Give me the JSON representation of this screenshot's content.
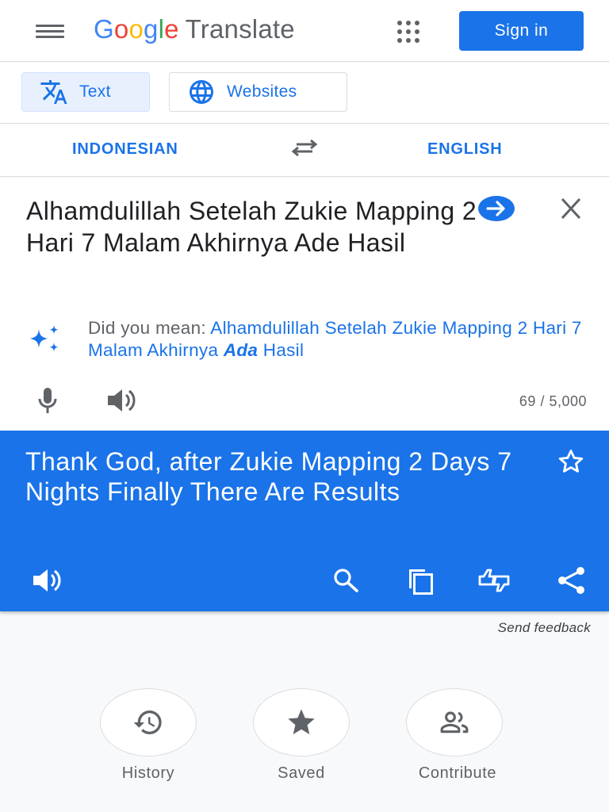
{
  "header": {
    "logo_letters": [
      "G",
      "o",
      "o",
      "g",
      "l",
      "e"
    ],
    "product_name": "Translate",
    "signin_label": "Sign in",
    "menu_icon": "hamburger-menu-icon",
    "apps_icon": "apps-grid-icon"
  },
  "modes": {
    "text_label": "Text",
    "websites_label": "Websites"
  },
  "languages": {
    "source": "INDONESIAN",
    "target": "ENGLISH"
  },
  "source": {
    "text": "Alhamdulillah Setelah Zukie Mapping 2 Hari 7 Malam Akhirnya Ade Hasil",
    "did_you_mean_label": "Did you mean: ",
    "suggestion_before": "Alhamdulillah Setelah Zukie Mapping 2 Hari 7 Malam Akhirnya ",
    "suggestion_corrected": "Ada",
    "suggestion_after": " Hasil",
    "char_count": "69 / 5,000"
  },
  "target": {
    "text": "Thank God, after Zukie Mapping 2 Days 7 Nights Finally There Are Results"
  },
  "feedback_label": "Send feedback",
  "bottom_actions": [
    {
      "label": "History",
      "icon": "history-icon"
    },
    {
      "label": "Saved",
      "icon": "star-icon"
    },
    {
      "label": "Contribute",
      "icon": "people-icon"
    }
  ],
  "colors": {
    "accent": "#1a73e8",
    "active_tab_bg": "#e8f0fe",
    "text_primary": "#202124",
    "text_secondary": "#5f6368"
  }
}
